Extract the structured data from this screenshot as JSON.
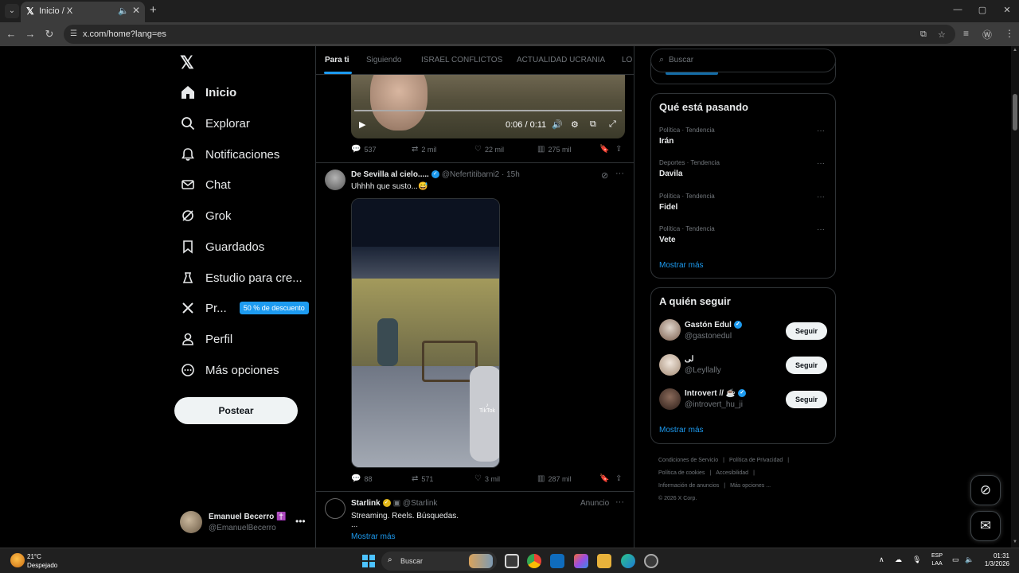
{
  "browser": {
    "tab_title": "Inicio / X",
    "url": "x.com/home?lang=es"
  },
  "sidebar": {
    "logo": "X",
    "items": [
      {
        "label": "Inicio",
        "icon": "home-icon",
        "active": true
      },
      {
        "label": "Explorar",
        "icon": "search-icon"
      },
      {
        "label": "Notificaciones",
        "icon": "bell-icon"
      },
      {
        "label": "Chat",
        "icon": "mail-icon"
      },
      {
        "label": "Grok",
        "icon": "grok-icon"
      },
      {
        "label": "Guardados",
        "icon": "bookmark-icon"
      },
      {
        "label": "Estudio para cre...",
        "icon": "creator-studio-icon"
      },
      {
        "label": "Pr...",
        "icon": "x-premium-icon",
        "badge": "50 % de descuento"
      },
      {
        "label": "Perfil",
        "icon": "person-icon"
      },
      {
        "label": "Más opciones",
        "icon": "more-circle-icon"
      }
    ],
    "post_button": "Postear",
    "account": {
      "name": "Emanuel Becerro",
      "name_emoji": "✝️",
      "handle": "@EmanuelBecerro"
    }
  },
  "feed": {
    "tabs": [
      "Para ti",
      "Siguiendo",
      "ISRAEL CONFLICTOS",
      "ACTUALIDAD UCRANIA",
      "LO"
    ],
    "video1": {
      "time": "0:06 / 0:11",
      "replies": "537",
      "reposts": "2 mil",
      "likes": "22 mil",
      "views": "275 mil"
    },
    "tweet2": {
      "name": "De Sevilla al cielo.....",
      "handle": "@Nefertitibarni2",
      "time": "15h",
      "text": "Uhhhh que susto...😅",
      "tiktok": "TikTok",
      "replies": "88",
      "reposts": "571",
      "likes": "3 mil",
      "views": "287 mil"
    },
    "tweet3": {
      "name": "Starlink",
      "handle": "@Starlink",
      "label": "Anuncio",
      "text": "Streaming. Reels. Búsquedas.",
      "ellipsis": "...",
      "show_more": "Mostrar más"
    }
  },
  "right": {
    "search_placeholder": "Buscar",
    "trends_title": "Qué está pasando",
    "trends": [
      {
        "category": "Política · Tendencia",
        "name": "Irán"
      },
      {
        "category": "Deportes · Tendencia",
        "name": "Davila"
      },
      {
        "category": "Política · Tendencia",
        "name": "Fidel"
      },
      {
        "category": "Política · Tendencia",
        "name": "Vete"
      }
    ],
    "trends_more": "Mostrar más",
    "follow_title": "A quién seguir",
    "follow": [
      {
        "name": "Gastón Edul",
        "handle": "@gastonedul",
        "verified": true,
        "button": "Seguir"
      },
      {
        "name": "لى",
        "handle": "@Leyllally",
        "verified": false,
        "button": "Seguir"
      },
      {
        "name": "Introvert // ☕",
        "handle": "@introvert_hu_ji",
        "verified": true,
        "button": "Seguir"
      }
    ],
    "follow_more": "Mostrar más",
    "footer": [
      "Condiciones de Servicio",
      "|",
      "Política de Privacidad",
      "|",
      "Política de cookies",
      "|",
      "Accesibilidad",
      "|",
      "Información de anuncios",
      "|",
      "Más opciones ...",
      "© 2026 X Corp."
    ]
  },
  "taskbar": {
    "temp": "21°C",
    "weather": "Despejado",
    "search": "Buscar",
    "lang_top": "ESP",
    "lang_bottom": "LAA",
    "time": "01:31",
    "date": "1/3/2026"
  },
  "colors": {
    "accent": "#1d9bf0",
    "background": "#000000",
    "border": "#2f3336",
    "muted": "#71767b"
  }
}
